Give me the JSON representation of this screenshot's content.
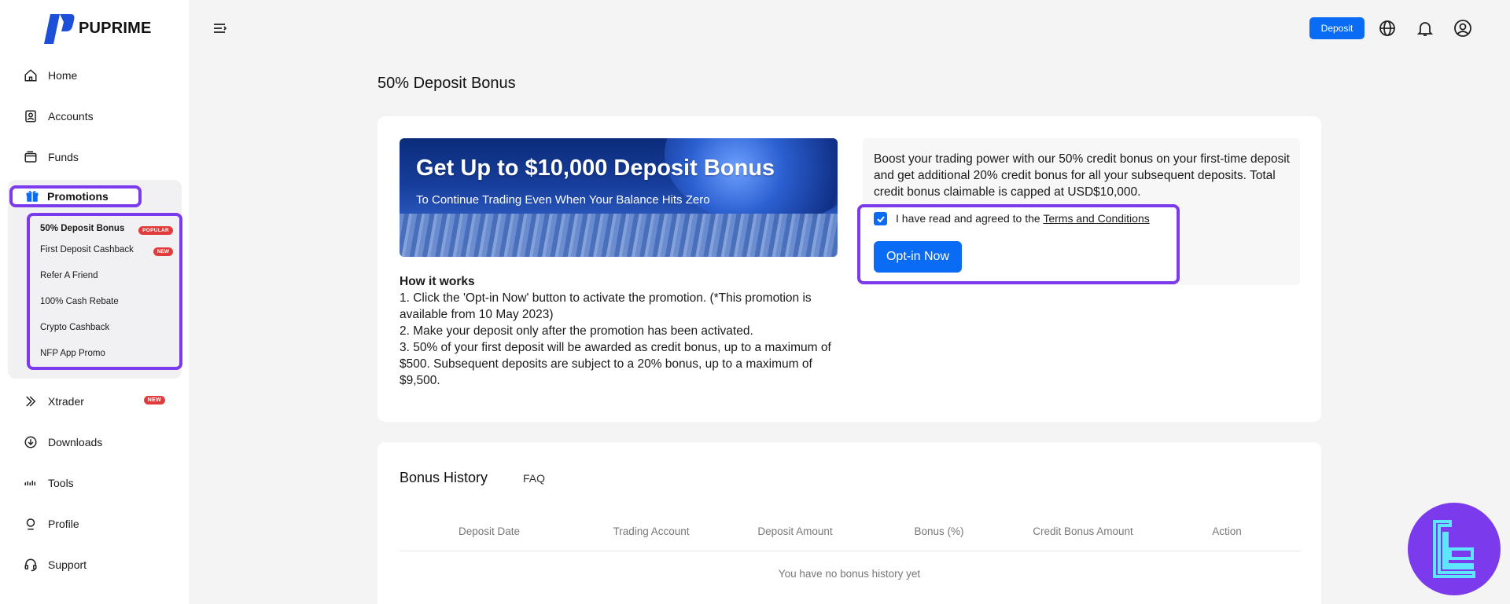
{
  "brand": {
    "name": "PUPRIME"
  },
  "sidebar": {
    "items": [
      {
        "label": "Home",
        "icon": "home-icon"
      },
      {
        "label": "Accounts",
        "icon": "account-icon"
      },
      {
        "label": "Funds",
        "icon": "wallet-icon"
      },
      {
        "label": "Promotions",
        "icon": "gift-icon"
      },
      {
        "label": "Xtrader",
        "icon": "xtrader-icon",
        "badge": "NEW"
      },
      {
        "label": "Downloads",
        "icon": "download-icon"
      },
      {
        "label": "Tools",
        "icon": "tools-icon"
      },
      {
        "label": "Profile",
        "icon": "profile-icon"
      },
      {
        "label": "Support",
        "icon": "headset-icon"
      }
    ],
    "promotions": [
      {
        "label": "50% Deposit Bonus",
        "badge": "POPULAR",
        "active": true
      },
      {
        "label": "First Deposit Cashback",
        "badge": "NEW"
      },
      {
        "label": "Refer A Friend"
      },
      {
        "label": "100% Cash Rebate"
      },
      {
        "label": "Crypto Cashback"
      },
      {
        "label": "NFP App Promo"
      }
    ]
  },
  "topbar": {
    "deposit_label": "Deposit"
  },
  "page": {
    "title": "50% Deposit Bonus"
  },
  "banner": {
    "title": "Get Up to $10,000 Deposit Bonus",
    "subtitle": "To Continue Trading Even When Your Balance Hits Zero"
  },
  "how_it_works": {
    "title": "How it works",
    "steps": [
      "1. Click the 'Opt-in Now' button to activate the promotion. (*This promotion is available from 10 May 2023)",
      "2. Make your deposit only after the promotion has been activated.",
      "3. 50% of your first deposit will be awarded as credit bonus, up to a maximum of $500. Subsequent deposits are subject to a 20% bonus, up to a maximum of $9,500."
    ]
  },
  "info": {
    "text": "Boost your trading power with our 50% credit bonus on your first-time deposit and get additional 20% credit bonus for all your subsequent deposits. Total credit bonus claimable is capped at USD$10,000.",
    "agree_prefix": "I have read and agreed to the",
    "agree_link": "Terms and Conditions",
    "checked": true,
    "opt_in_label": "Opt-in Now"
  },
  "history": {
    "tabs": [
      "Bonus History",
      "FAQ"
    ],
    "columns": [
      "Deposit Date",
      "Trading Account",
      "Deposit Amount",
      "Bonus (%)",
      "Credit Bonus Amount",
      "Action"
    ],
    "empty_text": "You have no bonus history yet"
  },
  "colors": {
    "accent": "#0a6cf5",
    "highlight": "#7c3aed",
    "badge": "#e23b3b"
  }
}
